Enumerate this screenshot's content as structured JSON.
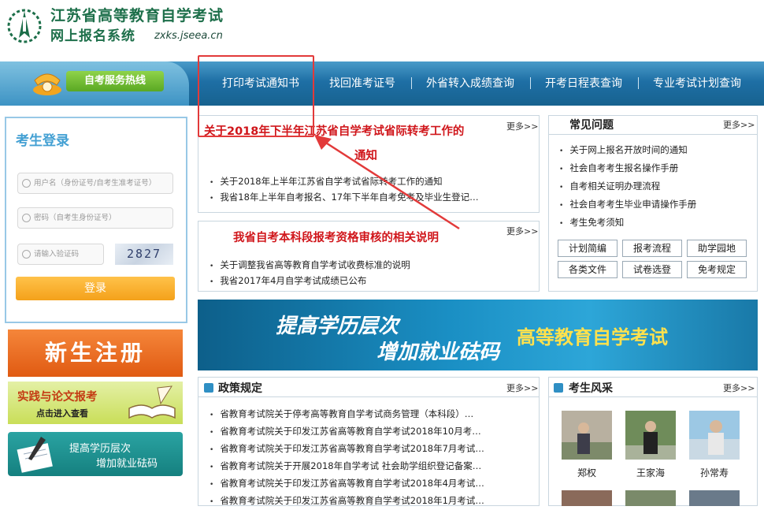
{
  "header": {
    "title": "江苏省高等教育自学考试",
    "subtitle": "网上报名系统",
    "domain": "zxks.jseea.cn"
  },
  "hotline": {
    "label": "自考服务热线"
  },
  "nav": {
    "items": [
      {
        "label": "打印考试通知书"
      },
      {
        "label": "找回准考证号"
      },
      {
        "label": "外省转入成绩查询"
      },
      {
        "label": "开考日程表查询"
      },
      {
        "label": "专业考试计划查询"
      }
    ]
  },
  "login": {
    "title": "考生登录",
    "username_placeholder": "用户名（身份证号/自考生准考证号）",
    "password_placeholder": "密码（自考生身份证号）",
    "captcha_placeholder": "请输入验证码",
    "captcha_text": "2827",
    "button": "登录"
  },
  "left_banners": {
    "register": "新生注册",
    "practice_title": "实践与论文报考",
    "practice_sub": "点击进入查看",
    "edu_line1": "提高学历层次",
    "edu_line2": "增加就业砝码"
  },
  "notice1": {
    "headline_line1": "关于2018年下半年江苏省自学考试省际转考工作的",
    "headline_line2": "通知",
    "more": "更多>>",
    "items": [
      "关于2018年上半年江苏省自学考试省际转考工作的通知",
      "我省18年上半年自考报名、17年下半年自考免考及毕业生登记…"
    ]
  },
  "notice2": {
    "headline": "我省自考本科段报考资格审核的相关说明",
    "more": "更多>>",
    "items": [
      "关于调整我省高等教育自学考试收费标准的说明",
      "我省2017年4月自学考试成绩已公布"
    ]
  },
  "faq": {
    "title": "常见问题",
    "more": "更多>>",
    "items": [
      "关于网上报名开放时间的通知",
      "社会自考考生报名操作手册",
      "自考相关证明办理流程",
      "社会自考考生毕业申请操作手册",
      "考生免考须知"
    ],
    "buttons": [
      "计划简编",
      "报考流程",
      "助学园地",
      "各类文件",
      "试卷选登",
      "免考规定"
    ]
  },
  "banner": {
    "line1": "提高学历层次",
    "line2": "增加就业砝码",
    "right": "高等教育自学考试"
  },
  "policy": {
    "title": "政策规定",
    "more": "更多>>",
    "items": [
      "省教育考试院关于停考高等教育自学考试商务管理（本科段）…",
      "省教育考试院关于印发江苏省高等教育自学考试2018年10月考…",
      "省教育考试院关于印发江苏省高等教育自学考试2018年7月考试…",
      "省教育考试院关于开展2018年自学考试 社会助学组织登记备案…",
      "省教育考试院关于印发江苏省高等教育自学考试2018年4月考试…",
      "省教育考试院关于印发江苏省高等教育自学考试2018年1月考试…"
    ]
  },
  "students": {
    "title": "考生风采",
    "more": "更多>>",
    "items": [
      {
        "name": "郑权"
      },
      {
        "name": "王家海"
      },
      {
        "name": "孙常寿"
      }
    ]
  },
  "colors": {
    "brand_green": "#1d6f4a",
    "nav_blue": "#1e6fa5",
    "annotation_red": "#e23a3a",
    "headline_red": "#d0161b"
  }
}
